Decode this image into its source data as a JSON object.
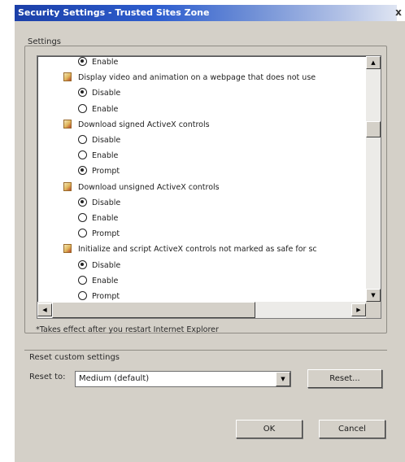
{
  "window": {
    "title": "Security Settings - Trusted Sites Zone",
    "close_glyph": "x"
  },
  "settings": {
    "label": "Settings",
    "list": [
      {
        "kind": "option",
        "label": "Enable",
        "checked": true
      },
      {
        "kind": "setting",
        "label": "Display video and animation on a webpage that does not use",
        "icon": "settings-item-icon"
      },
      {
        "kind": "option",
        "label": "Disable",
        "checked": true
      },
      {
        "kind": "option",
        "label": "Enable",
        "checked": false
      },
      {
        "kind": "setting",
        "label": "Download signed ActiveX controls",
        "icon": "settings-item-icon"
      },
      {
        "kind": "option",
        "label": "Disable",
        "checked": false
      },
      {
        "kind": "option",
        "label": "Enable",
        "checked": false
      },
      {
        "kind": "option",
        "label": "Prompt",
        "checked": true
      },
      {
        "kind": "setting",
        "label": "Download unsigned ActiveX controls",
        "icon": "settings-item-icon"
      },
      {
        "kind": "option",
        "label": "Disable",
        "checked": true
      },
      {
        "kind": "option",
        "label": "Enable",
        "checked": false
      },
      {
        "kind": "option",
        "label": "Prompt",
        "checked": false
      },
      {
        "kind": "setting",
        "label": "Initialize and script ActiveX controls not marked as safe for sc",
        "icon": "settings-item-icon"
      },
      {
        "kind": "option",
        "label": "Disable",
        "checked": true
      },
      {
        "kind": "option",
        "label": "Enable",
        "checked": false
      },
      {
        "kind": "option",
        "label": "Prompt",
        "checked": false
      }
    ],
    "note": "*Takes effect after you restart Internet Explorer"
  },
  "reset": {
    "group_label": "Reset custom settings",
    "reset_to_label": "Reset to:",
    "selected_value": "Medium (default)",
    "reset_button": "Reset..."
  },
  "footer": {
    "ok_label": "OK",
    "cancel_label": "Cancel"
  },
  "colors": {
    "title_gradient_start": "#1b3fa8",
    "panel": "#d4d0c8",
    "list_bg": "#ffffff"
  }
}
